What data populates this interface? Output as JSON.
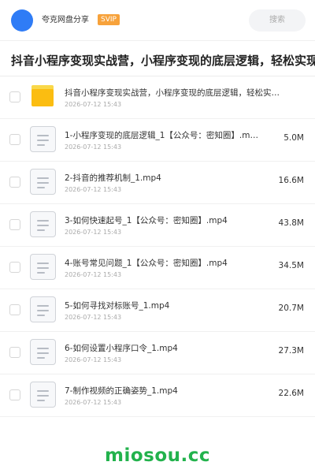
{
  "header": {
    "sharer_name": "夸克网盘分享",
    "badge": "SVIP",
    "search_placeholder": "搜索"
  },
  "share_title": "抖音小程序变现实战营，小程序变现的底层逻辑，轻松实现",
  "files": [
    {
      "name": "抖音小程序变现实战营，小程序变现的底层逻辑，轻松实…",
      "date": "2026-07-12 15:43",
      "size": "",
      "icon": "folder-icon"
    },
    {
      "name": "1-小程序变现的底层逻辑_1【公众号：密知圈】.m…",
      "date": "2026-07-12 15:43",
      "size": "5.0M",
      "icon": "document-icon"
    },
    {
      "name": "2-抖音的推荐机制_1.mp4",
      "date": "2026-07-12 15:43",
      "size": "16.6M",
      "icon": "document-icon"
    },
    {
      "name": "3-如何快速起号_1【公众号：密知圈】.mp4",
      "date": "2026-07-12 15:43",
      "size": "43.8M",
      "icon": "document-icon"
    },
    {
      "name": "4-账号常见问题_1【公众号：密知圈】.mp4",
      "date": "2026-07-12 15:43",
      "size": "34.5M",
      "icon": "document-icon"
    },
    {
      "name": "5-如何寻找对标账号_1.mp4",
      "date": "2026-07-12 15:43",
      "size": "20.7M",
      "icon": "document-icon"
    },
    {
      "name": "6-如何设置小程序口令_1.mp4",
      "date": "2026-07-12 15:43",
      "size": "27.3M",
      "icon": "document-icon"
    },
    {
      "name": "7-制作视频的正确姿势_1.mp4",
      "date": "2026-07-12 15:43",
      "size": "22.6M",
      "icon": "document-icon"
    }
  ],
  "watermark": "miosou.cc",
  "colors": {
    "avatar": "#2f7cf6",
    "badge": "#f7a23b",
    "folder": "#fbbd11",
    "watermark": "#22b24c"
  }
}
